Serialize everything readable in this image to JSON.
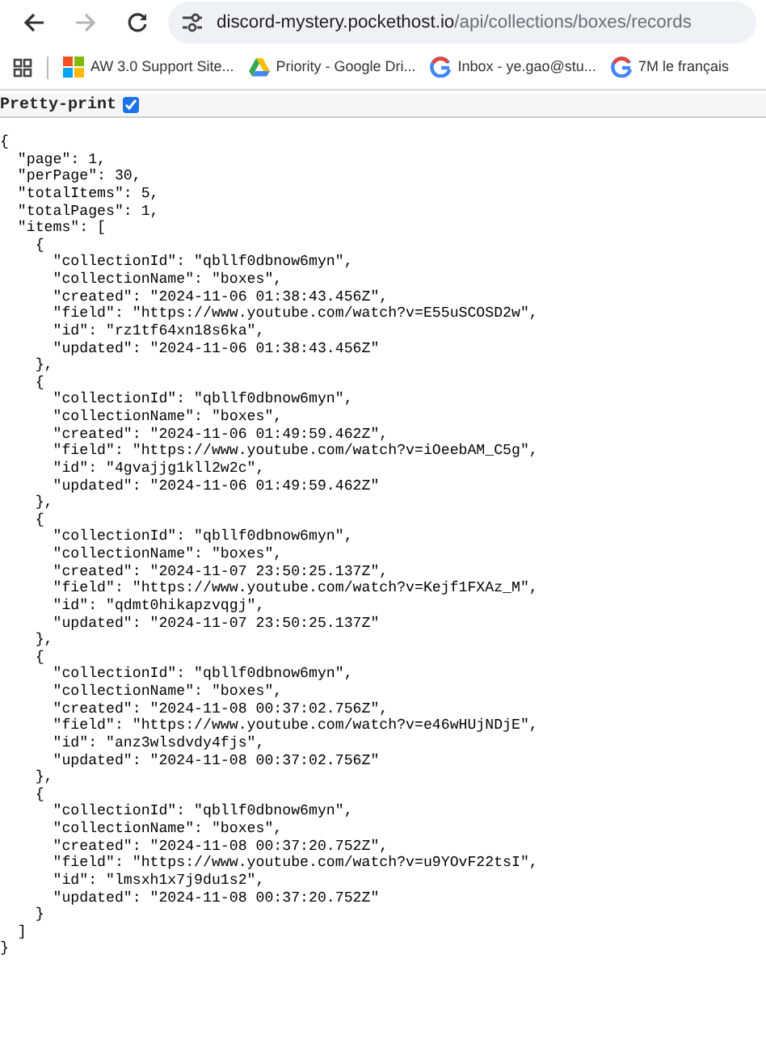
{
  "toolbar": {
    "forward_disabled": true,
    "url_host": "discord-mystery.pockethost.io",
    "url_path": "/api/collections/boxes/records"
  },
  "bookmarks": [
    {
      "kind": "squares",
      "label": "AW 3.0 Support Site..."
    },
    {
      "kind": "triangle",
      "label": "Priority - Google Dri..."
    },
    {
      "kind": "ring",
      "label": "Inbox - ye.gao@stu..."
    },
    {
      "kind": "ring",
      "label": "7M le français"
    }
  ],
  "pretty_print": {
    "label": "Pretty-print",
    "checked": true
  },
  "json_lines": [
    "{",
    "  \"page\": 1,",
    "  \"perPage\": 30,",
    "  \"totalItems\": 5,",
    "  \"totalPages\": 1,",
    "  \"items\": [",
    "    {",
    "      \"collectionId\": \"qbllf0dbnow6myn\",",
    "      \"collectionName\": \"boxes\",",
    "      \"created\": \"2024-11-06 01:38:43.456Z\",",
    "      \"field\": \"https://www.youtube.com/watch?v=E55uSCOSD2w\",",
    "      \"id\": \"rz1tf64xn18s6ka\",",
    "      \"updated\": \"2024-11-06 01:38:43.456Z\"",
    "    },",
    "    {",
    "      \"collectionId\": \"qbllf0dbnow6myn\",",
    "      \"collectionName\": \"boxes\",",
    "      \"created\": \"2024-11-06 01:49:59.462Z\",",
    "      \"field\": \"https://www.youtube.com/watch?v=iOeebAM_C5g\",",
    "      \"id\": \"4gvajjg1kll2w2c\",",
    "      \"updated\": \"2024-11-06 01:49:59.462Z\"",
    "    },",
    "    {",
    "      \"collectionId\": \"qbllf0dbnow6myn\",",
    "      \"collectionName\": \"boxes\",",
    "      \"created\": \"2024-11-07 23:50:25.137Z\",",
    "      \"field\": \"https://www.youtube.com/watch?v=Kejf1FXAz_M\",",
    "      \"id\": \"qdmt0hikapzvqgj\",",
    "      \"updated\": \"2024-11-07 23:50:25.137Z\"",
    "    },",
    "    {",
    "      \"collectionId\": \"qbllf0dbnow6myn\",",
    "      \"collectionName\": \"boxes\",",
    "      \"created\": \"2024-11-08 00:37:02.756Z\",",
    "      \"field\": \"https://www.youtube.com/watch?v=e46wHUjNDjE\",",
    "      \"id\": \"anz3wlsdvdy4fjs\",",
    "      \"updated\": \"2024-11-08 00:37:02.756Z\"",
    "    },",
    "    {",
    "      \"collectionId\": \"qbllf0dbnow6myn\",",
    "      \"collectionName\": \"boxes\",",
    "      \"created\": \"2024-11-08 00:37:20.752Z\",",
    "      \"field\": \"https://www.youtube.com/watch?v=u9YOvF22tsI\",",
    "      \"id\": \"lmsxh1x7j9du1s2\",",
    "      \"updated\": \"2024-11-08 00:37:20.752Z\"",
    "    }",
    "  ]",
    "}"
  ]
}
